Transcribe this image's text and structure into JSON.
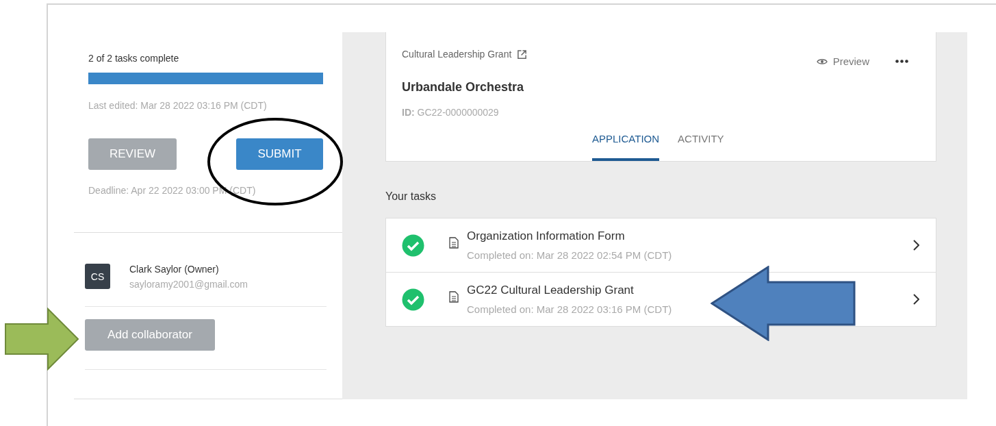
{
  "progress": {
    "label": "2 of 2 tasks complete",
    "level": 1.0
  },
  "last_edited": "Last edited: Mar 28 2022 03:16 PM (CDT)",
  "buttons": [
    {
      "label": "REVIEW",
      "kind": "secondary"
    },
    {
      "label": "SUBMIT",
      "kind": "primary"
    }
  ],
  "deadline": "Deadline: Apr 22 2022 03:00 PM (CDT)",
  "collaborators": [
    {
      "initials": "CS",
      "name": "Clark Saylor (Owner)",
      "email": "sayloramy2001@gmail.com"
    }
  ],
  "add_collaborator": "Add collaborator",
  "header": {
    "program": "Cultural Leadership Grant",
    "title": "Urbandale Orchestra",
    "id_label": "ID:",
    "id_value": "GC22-0000000029",
    "preview": "Preview"
  },
  "tabs": [
    {
      "label": "APPLICATION",
      "selected": true
    },
    {
      "label": "ACTIVITY",
      "selected": false
    }
  ],
  "tasks_heading": "Your tasks",
  "tasks": [
    {
      "title": "Organization Information Form",
      "completed": "Completed on: Mar 28 2022 02:54 PM (CDT)",
      "done": true
    },
    {
      "title": "GC22 Cultural Leadership Grant",
      "completed": "Completed on: Mar 28 2022 03:16 PM (CDT)",
      "done": true
    }
  ],
  "annotations": [
    {
      "kind": "ellipse",
      "color": "#000000"
    },
    {
      "kind": "arrow-right",
      "color": "#9bbb59"
    },
    {
      "kind": "arrow-left",
      "color": "#4f81bd"
    }
  ]
}
